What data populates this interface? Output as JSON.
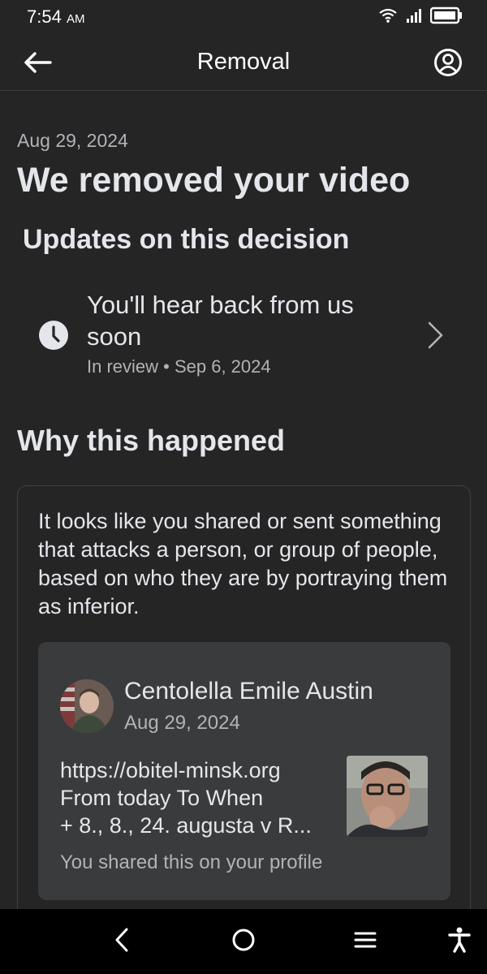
{
  "status_bar": {
    "time": "7:54",
    "ampm": "AM"
  },
  "header": {
    "title": "Removal"
  },
  "main": {
    "date": "Aug 29, 2024",
    "title": "We removed your video",
    "updates_heading": "Updates on this decision",
    "update": {
      "text": "You'll hear back from us soon",
      "status": "In review • Sep 6, 2024"
    },
    "why_heading": "Why this happened",
    "explanation": "It looks like you shared or sent something that attacks a person, or group of people, based on who they are by portraying them as inferior.",
    "post": {
      "author": "Centolella Emile Austin",
      "date": "Aug 29, 2024",
      "lines": [
        "https://obitel-minsk.org",
        "From today To When",
        "+ 8., 8., 24. augusta v R..."
      ],
      "footer": "You shared this on your profile"
    }
  },
  "colors": {
    "background": "#252526",
    "card_inner": "#3a3b3c",
    "text_primary": "#e4e6eb",
    "text_secondary": "#b0b3b8"
  },
  "icons": [
    "wifi-icon",
    "signal-icon",
    "battery-icon",
    "back-arrow-icon",
    "profile-icon",
    "clock-icon",
    "chevron-right-icon",
    "nav-back-icon",
    "nav-home-icon",
    "nav-menu-icon",
    "accessibility-icon"
  ]
}
